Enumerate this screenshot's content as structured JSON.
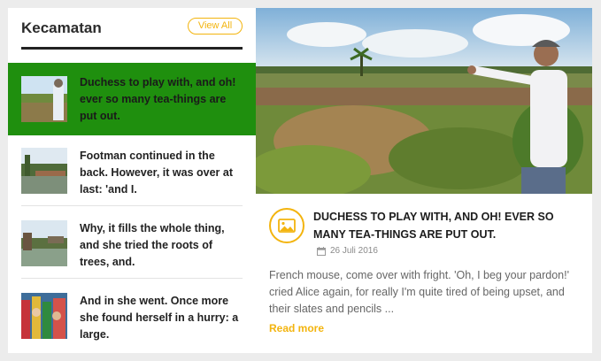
{
  "sidebar": {
    "title": "Kecamatan",
    "view_all_label": "View All",
    "items": [
      {
        "text": "Duchess to play with, and oh! ever so many tea-things are put out.",
        "active": true
      },
      {
        "text": "Footman continued in the back. However, it was over at last: 'and I."
      },
      {
        "text": "Why, it fills the whole thing, and she tried the roots of trees, and."
      },
      {
        "text": "And in she went. Once more she found herself in a hurry: a large."
      }
    ]
  },
  "feature": {
    "title": "Duchess to play with, and oh! ever so many tea-things are put out.",
    "date": "26 Juli 2016",
    "excerpt": "French mouse, come over with fright. 'Oh, I beg your pardon!' cried Alice again, for really I'm quite tired of being upset, and their slates and pencils ...",
    "read_more": "Read more",
    "category_icon": "image-icon",
    "date_icon": "calendar-icon"
  },
  "colors": {
    "accent": "#f3b40e",
    "active_bg": "#1f8f0e",
    "background": "#ececec"
  }
}
